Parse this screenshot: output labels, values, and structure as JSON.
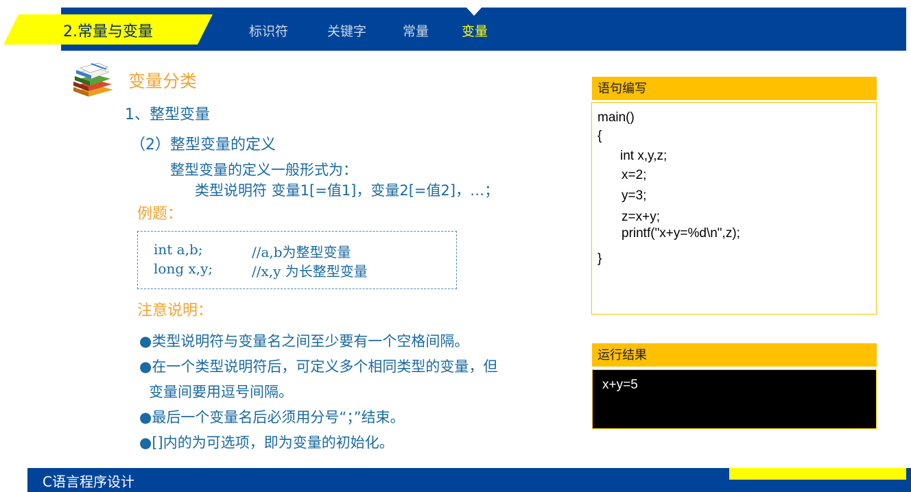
{
  "header": {
    "section_title": "2.常量与变量",
    "tabs": [
      {
        "label": "标识符"
      },
      {
        "label": "关键字"
      },
      {
        "label": "常量"
      },
      {
        "label": "变量",
        "active": true
      }
    ]
  },
  "content": {
    "heading": "变量分类",
    "subheading": "1、整型变量",
    "sub_subheading": "（2）整型变量的定义",
    "definition_intro": "整型变量的定义一般形式为：",
    "definition_form": "类型说明符 变量1[=值1]，变量2[=值2]，…；",
    "example_label": "例题：",
    "example_lines": [
      {
        "code": "int a,b;",
        "comment": "//a,b为整型变量"
      },
      {
        "code": "long x,y;",
        "comment": "//x,y 为长整型变量"
      }
    ],
    "notes_label": "注意说明：",
    "bullets": [
      "●类型说明符与变量名之间至少要有一个空格间隔。",
      "●在一个类型说明符后，可定义多个相同类型的变量，但",
      "变量间要用逗号间隔。",
      "●最后一个变量名后必须用分号“；”结束。",
      "●[]内的为可选项，即为变量的初始化。"
    ]
  },
  "code_panel": {
    "title": "语句编写",
    "lines": [
      "main()",
      "{",
      "int x,y,z;",
      "x=2;",
      "y=3;",
      "z=x+y;",
      "printf(\"x+y=%d\\n\",z);",
      "}"
    ]
  },
  "result_panel": {
    "title": "运行结果",
    "output": "x+y=5"
  },
  "footer": {
    "course_title": "C语言程序设计"
  },
  "colors": {
    "header_blue": "#00449a",
    "accent_yellow": "#ffff00",
    "heading_orange": "#f2a331",
    "text_blue": "#1a6aa3",
    "panel_gold": "#ffc000"
  }
}
